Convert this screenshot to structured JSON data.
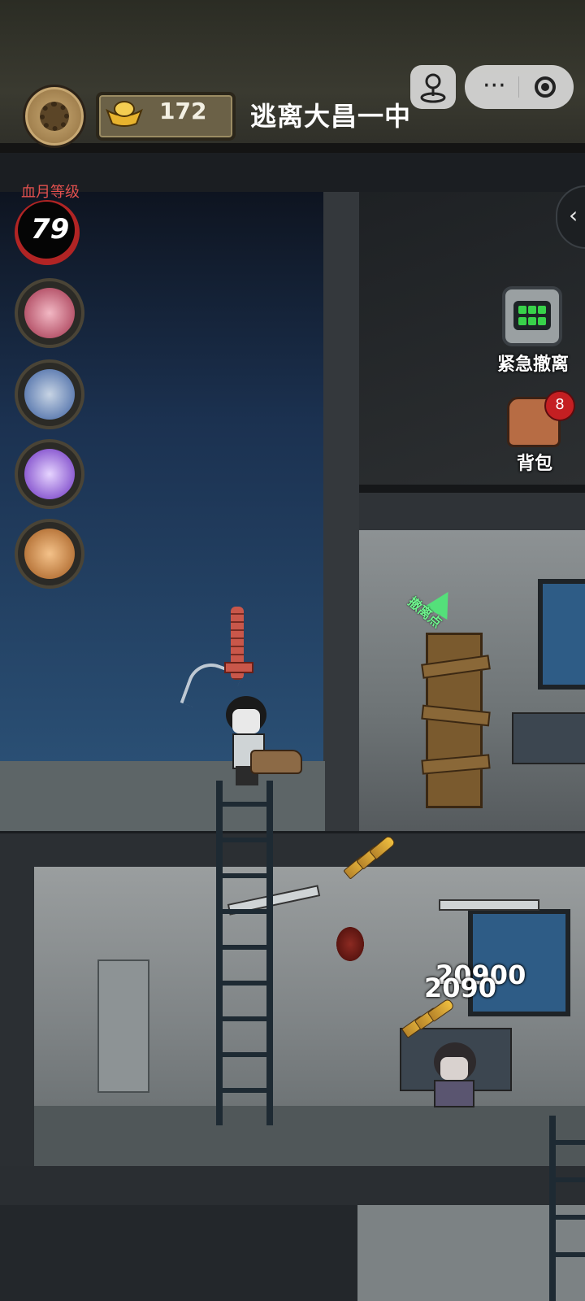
{
  "header": {
    "gold_value": "172",
    "title": "逃离大昌一中"
  },
  "sidebar": {
    "blood_moon_label": "血月等级",
    "blood_moon_level": "79",
    "skills": [
      {
        "icon": "revolver-skill-icon"
      },
      {
        "icon": "shield-skill-icon"
      },
      {
        "icon": "cross-skill-icon"
      },
      {
        "icon": "rosary-sword-skill-icon"
      }
    ]
  },
  "right_panel": {
    "evac_label": "紧急撤离",
    "bag_label": "背包",
    "bag_badge": "8"
  },
  "scene": {
    "evac_point_label": "撤离点",
    "damage_numbers": [
      "20900",
      "2090"
    ]
  },
  "colors": {
    "blood_red": "#b12424",
    "evac_green": "#54e07a",
    "badge_red": "#c41f22"
  }
}
